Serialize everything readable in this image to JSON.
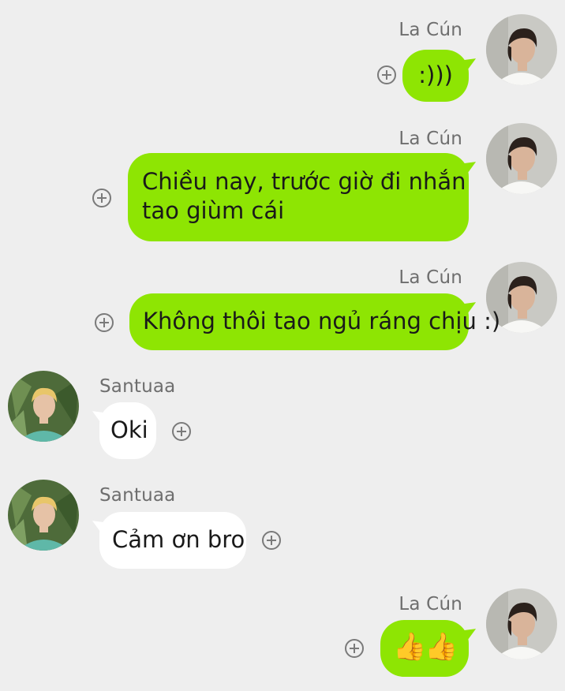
{
  "me": {
    "name": "La Cún"
  },
  "other": {
    "name": "Santuaa"
  },
  "messages": [
    {
      "sender": "me",
      "name": "La Cún",
      "lines": [
        ":)))"
      ]
    },
    {
      "sender": "me",
      "name": "La Cún",
      "lines": [
        "Chiều nay, trước giờ đi nhắn",
        "tao giùm cái"
      ]
    },
    {
      "sender": "me",
      "name": "La Cún",
      "lines": [
        "Không thôi tao ngủ ráng chịu :)"
      ]
    },
    {
      "sender": "other",
      "name": "Santuaa",
      "lines": [
        "Oki"
      ]
    },
    {
      "sender": "other",
      "name": "Santuaa",
      "lines": [
        "Cảm ơn bro"
      ]
    },
    {
      "sender": "me",
      "name": "La Cún",
      "lines": [
        "👍👍"
      ]
    }
  ],
  "colors": {
    "background": "#eeeeee",
    "my_bubble": "#8ee503",
    "other_bubble": "#ffffff",
    "name_text": "#6e6e6e"
  },
  "icons": {
    "add_reaction": "plus-circle-icon"
  }
}
